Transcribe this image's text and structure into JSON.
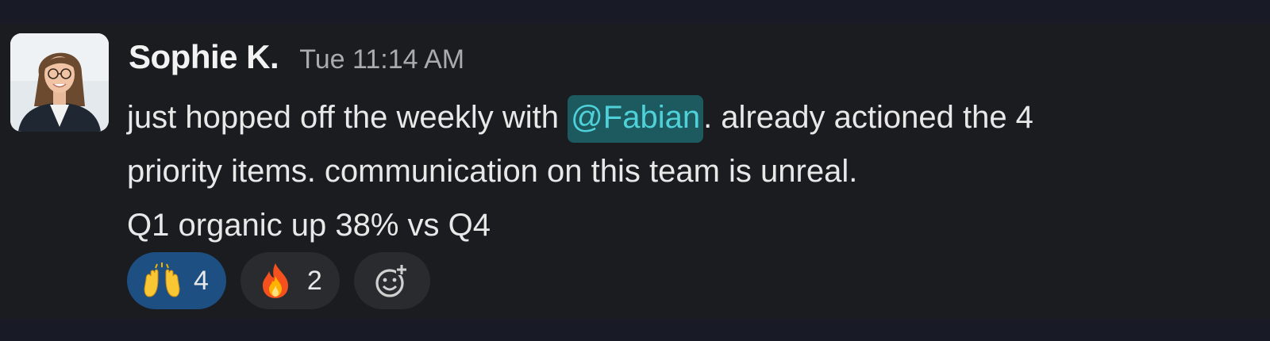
{
  "message": {
    "author": "Sophie K.",
    "timestamp": "Tue 11:14 AM",
    "lines": {
      "line1_before": "just hopped off the weekly with ",
      "mention": "@Fabian",
      "line1_after": ". already actioned the 4",
      "line2": "priority items. communication on this team is unreal.",
      "line3": "Q1 organic up 38% vs Q4"
    }
  },
  "reactions": [
    {
      "icon": "raising-hands-icon",
      "count": "4",
      "selected": true
    },
    {
      "icon": "fire-icon",
      "count": "2",
      "selected": false
    }
  ],
  "add_reaction": {
    "icon": "add-reaction-icon"
  },
  "colors": {
    "mention_text": "#4fd1d9",
    "mention_bg": "#1d5a5f",
    "selected_reaction_bg": "#1d4f82"
  }
}
